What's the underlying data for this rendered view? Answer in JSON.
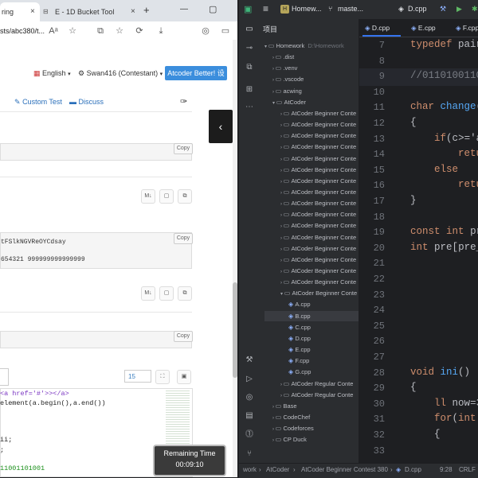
{
  "browser": {
    "tabs": [
      {
        "label": "ring",
        "close": "×"
      },
      {
        "label": "E - 1D Bucket Tool",
        "close": "×"
      }
    ],
    "new_tab": "+",
    "window_controls": [
      "—",
      "▢"
    ],
    "url": "sts/abc380/t...",
    "toolbar_icons": [
      "Aᵃ",
      "☆",
      "⧉",
      "⟳",
      "⤓",
      "◎",
      "▭"
    ],
    "site": {
      "language": "English",
      "user": "Swan416 (Contestant)",
      "atcoder_better_btn": "Atcoder Better! 设置",
      "custom_test": "Custom Test",
      "discuss": "Discuss"
    },
    "copy_label": "Copy",
    "sample_input_lines": [
      "tFSlkNGVReOYCdsay",
      "654321 999999999999999"
    ],
    "tool_buttons": [
      "M↓",
      "▢",
      "⧉"
    ],
    "font_size": "15",
    "code_lines": [
      "<a href='#'>></a>",
      "element(a.begin(),a.end())",
      "",
      "",
      "ii;",
      ";",
      "",
      "11001101001"
    ],
    "timer": {
      "label": "Remaining Time",
      "value": "00:09:10"
    }
  },
  "ide": {
    "top": {
      "project": "Homew...",
      "branch": "maste...",
      "file": "D.cpp"
    },
    "project_label": "项目",
    "tree": [
      {
        "label": "Homework",
        "suffix": "D:\\Homework",
        "depth": 0,
        "kind": "folder-open"
      },
      {
        "label": ".dist",
        "depth": 1,
        "kind": "folder"
      },
      {
        "label": ".venv",
        "depth": 1,
        "kind": "folder"
      },
      {
        "label": ".vscode",
        "depth": 1,
        "kind": "folder"
      },
      {
        "label": "acwing",
        "depth": 1,
        "kind": "folder"
      },
      {
        "label": "AtCoder",
        "depth": 1,
        "kind": "folder-open"
      },
      {
        "label": "AtCoder Beginner Conte",
        "depth": 2,
        "kind": "folder"
      },
      {
        "label": "AtCoder Beginner Conte",
        "depth": 2,
        "kind": "folder"
      },
      {
        "label": "AtCoder Beginner Conte",
        "depth": 2,
        "kind": "folder"
      },
      {
        "label": "AtCoder Beginner Conte",
        "depth": 2,
        "kind": "folder"
      },
      {
        "label": "AtCoder Beginner Conte",
        "depth": 2,
        "kind": "folder"
      },
      {
        "label": "AtCoder Beginner Conte",
        "depth": 2,
        "kind": "folder"
      },
      {
        "label": "AtCoder Beginner Conte",
        "depth": 2,
        "kind": "folder"
      },
      {
        "label": "AtCoder Beginner Conte",
        "depth": 2,
        "kind": "folder"
      },
      {
        "label": "AtCoder Beginner Conte",
        "depth": 2,
        "kind": "folder"
      },
      {
        "label": "AtCoder Beginner Conte",
        "depth": 2,
        "kind": "folder"
      },
      {
        "label": "AtCoder Beginner Conte",
        "depth": 2,
        "kind": "folder"
      },
      {
        "label": "AtCoder Beginner Conte",
        "depth": 2,
        "kind": "folder"
      },
      {
        "label": "AtCoder Beginner Conte",
        "depth": 2,
        "kind": "folder"
      },
      {
        "label": "AtCoder Beginner Conte",
        "depth": 2,
        "kind": "folder"
      },
      {
        "label": "AtCoder Beginner Conte",
        "depth": 2,
        "kind": "folder"
      },
      {
        "label": "AtCoder Beginner Conte",
        "depth": 2,
        "kind": "folder"
      },
      {
        "label": "AtCoder Beginner Conte",
        "depth": 2,
        "kind": "folder-open"
      },
      {
        "label": "A.cpp",
        "depth": 3,
        "kind": "file"
      },
      {
        "label": "B.cpp",
        "depth": 3,
        "kind": "file"
      },
      {
        "label": "C.cpp",
        "depth": 3,
        "kind": "file"
      },
      {
        "label": "D.cpp",
        "depth": 3,
        "kind": "file"
      },
      {
        "label": "E.cpp",
        "depth": 3,
        "kind": "file"
      },
      {
        "label": "F.cpp",
        "depth": 3,
        "kind": "file"
      },
      {
        "label": "G.cpp",
        "depth": 3,
        "kind": "file"
      },
      {
        "label": "AtCoder Regular Conte",
        "depth": 2,
        "kind": "folder"
      },
      {
        "label": "AtCoder Regular Conte",
        "depth": 2,
        "kind": "folder"
      },
      {
        "label": "Base",
        "depth": 1,
        "kind": "folder"
      },
      {
        "label": "CodeChef",
        "depth": 1,
        "kind": "folder"
      },
      {
        "label": "Codeforces",
        "depth": 1,
        "kind": "folder"
      },
      {
        "label": "CP Duck",
        "depth": 1,
        "kind": "folder"
      }
    ],
    "editor_tabs": [
      "D.cpp",
      "E.cpp",
      "F.cpp"
    ],
    "line_numbers": [
      "7",
      "8",
      "9",
      "10",
      "11",
      "12",
      "13",
      "14",
      "15",
      "16",
      "17",
      "18",
      "19",
      "20",
      "21",
      "22",
      "23",
      "24",
      "25",
      "26",
      "27",
      "28",
      "29",
      "30",
      "31",
      "32",
      "33"
    ],
    "code": [
      {
        "ln": "7",
        "text": "typedef pair"
      },
      {
        "ln": "8",
        "text": ""
      },
      {
        "ln": "9",
        "text": "//0110100110"
      },
      {
        "ln": "10",
        "text": ""
      },
      {
        "ln": "11",
        "text": "char change("
      },
      {
        "ln": "12",
        "text": "{"
      },
      {
        "ln": "13",
        "text": "    if(c>='a"
      },
      {
        "ln": "14",
        "text": "        retu"
      },
      {
        "ln": "15",
        "text": "    else"
      },
      {
        "ln": "16",
        "text": "        retu"
      },
      {
        "ln": "17",
        "text": "}"
      },
      {
        "ln": "18",
        "text": ""
      },
      {
        "ln": "19",
        "text": "const int pr"
      },
      {
        "ln": "20",
        "text": "int pre[pre_"
      },
      {
        "ln": "21",
        "text": ""
      },
      {
        "ln": "22",
        "text": ""
      },
      {
        "ln": "23",
        "text": ""
      },
      {
        "ln": "24",
        "text": ""
      },
      {
        "ln": "25",
        "text": ""
      },
      {
        "ln": "26",
        "text": ""
      },
      {
        "ln": "27",
        "text": ""
      },
      {
        "ln": "28",
        "text": "void ini()"
      },
      {
        "ln": "29",
        "text": "{"
      },
      {
        "ln": "30",
        "text": "    ll now=3"
      },
      {
        "ln": "31",
        "text": "    for(int"
      },
      {
        "ln": "32",
        "text": "    {"
      },
      {
        "ln": "33",
        "text": ""
      }
    ],
    "status": {
      "breadcrumb": [
        "work",
        "AtCoder",
        "AtCoder Beginner Contest 380",
        "D.cpp"
      ],
      "position": "9:28",
      "eol": "CRLF"
    }
  }
}
